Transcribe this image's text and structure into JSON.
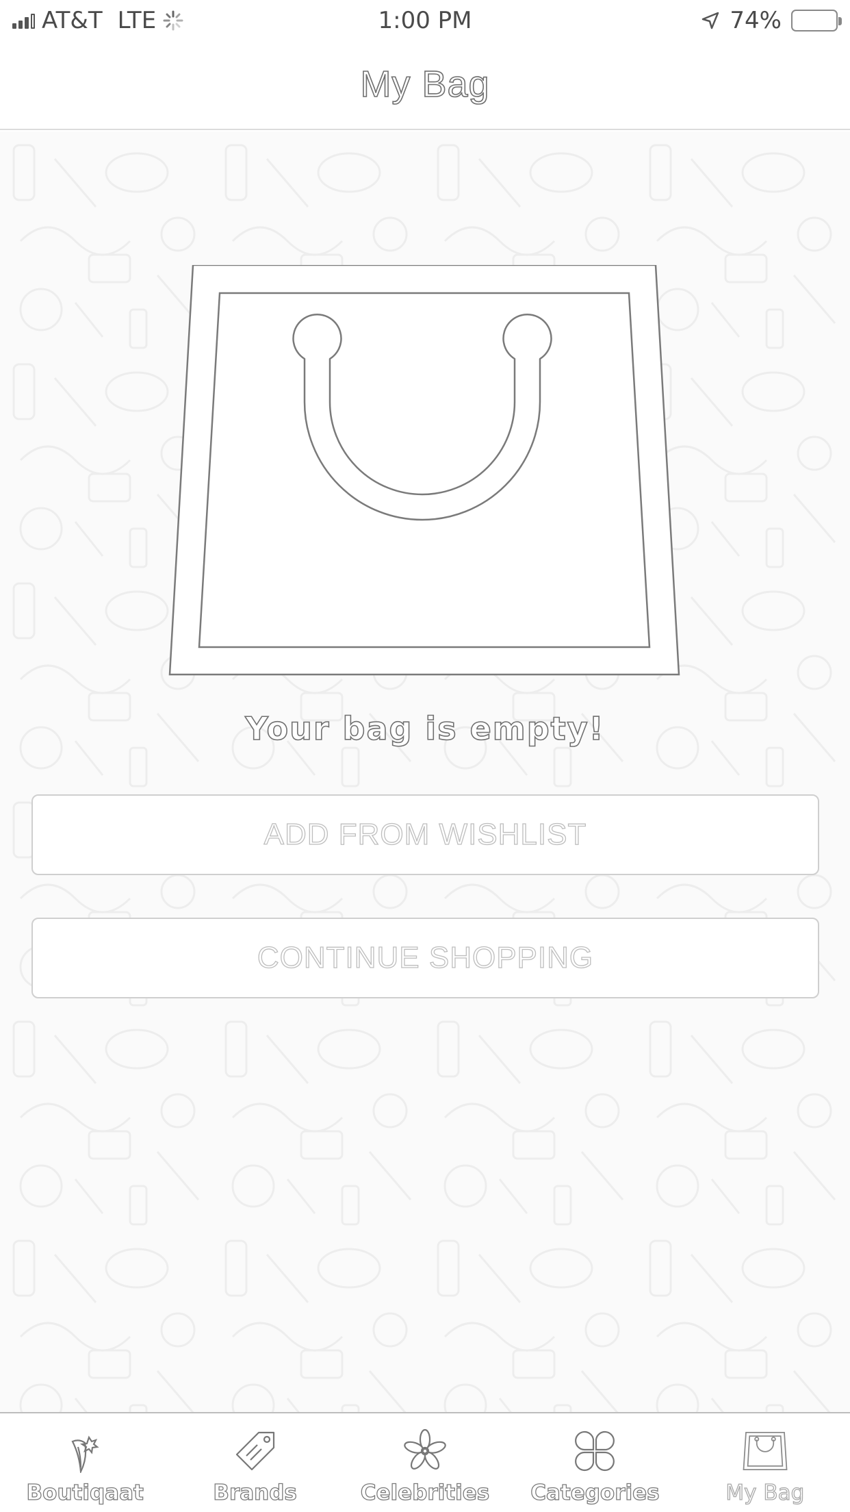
{
  "status_bar": {
    "carrier": "AT&T",
    "network": "LTE",
    "time": "1:00 PM",
    "battery": "74%",
    "icons": [
      "signal-icon",
      "loading-spinner-icon",
      "location-arrow-icon",
      "battery-icon"
    ]
  },
  "header": {
    "title": "My Bag"
  },
  "main": {
    "empty_message": "Your bag is empty!",
    "illustration": "shopping-bag-icon",
    "add_from_wishlist_label": "ADD FROM WISHLIST",
    "continue_shopping_label": "CONTINUE SHOPPING"
  },
  "tab_bar": {
    "active": "My Bag",
    "tabs": [
      {
        "label": "Boutiqaat",
        "icon": "boutiqaat-logo-icon"
      },
      {
        "label": "Brands",
        "icon": "tag-icon"
      },
      {
        "label": "Celebrities",
        "icon": "flower-icon"
      },
      {
        "label": "Categories",
        "icon": "grid-icon"
      },
      {
        "label": "My Bag",
        "icon": "bag-icon"
      }
    ]
  },
  "colors": {
    "background": "#ffffff",
    "pattern_background": "#fafafa",
    "outline_text": "#6e6e6e",
    "button_border": "#cfcfcf"
  }
}
